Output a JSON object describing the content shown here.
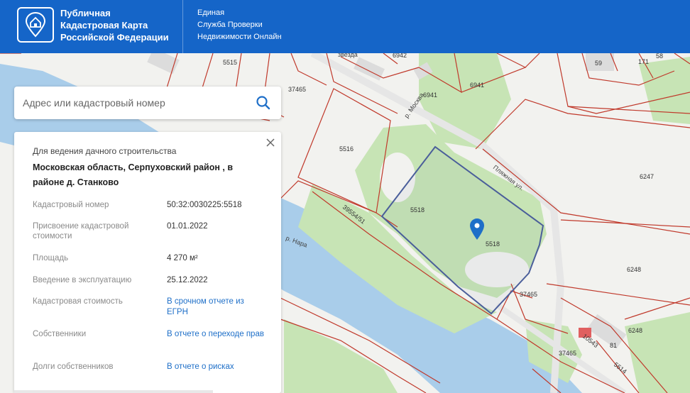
{
  "header": {
    "brand_lines": [
      "Публичная",
      "Кадастровая Карта",
      "Российской Федерации"
    ],
    "service_lines": [
      "Единая",
      "Служба Проверки",
      "Недвижимости Онлайн"
    ]
  },
  "search": {
    "placeholder": "Адрес или кадастровый номер",
    "icon": "search-icon"
  },
  "card": {
    "purpose": "Для ведения дачного строительства",
    "address": "Московская область, Серпуховский район , в районе д. Станково",
    "rows": [
      {
        "label": "Кадастровый номер",
        "value": "50:32:0030225:5518"
      },
      {
        "label": "Присвоение кадастровой стоимости",
        "value": "01.01.2022"
      },
      {
        "label": "Площадь",
        "value": "4 270 м²"
      },
      {
        "label": "Введение в эксплуатацию",
        "value": "25.12.2022"
      },
      {
        "label": "Кадастровая стоимость",
        "value": "В срочном отчете из ЕГРН"
      },
      {
        "label": "Собственники",
        "value": "В отчете о переходе прав"
      },
      {
        "label": "Долги собственников",
        "value": "В отчете о рисках"
      }
    ]
  },
  "map": {
    "labels": [
      "5515",
      "6942",
      "37465",
      "6941",
      "6941",
      "59",
      "171",
      "58",
      "5516",
      "6247",
      "5518",
      "5518",
      "39554/51",
      "6248",
      "37465",
      "6248",
      "37465",
      "81",
      "5514",
      "10543",
      "р. Нара",
      "Пляжная ул.",
      "р. Москва",
      "звезда"
    ]
  },
  "colors": {
    "header": "#1565c8",
    "boundary": "#c0392b",
    "selected_parcel": "#4a5e9a",
    "water": "#a9cdea",
    "green": "#c7e4b5",
    "marker": "#1e6fc8"
  }
}
